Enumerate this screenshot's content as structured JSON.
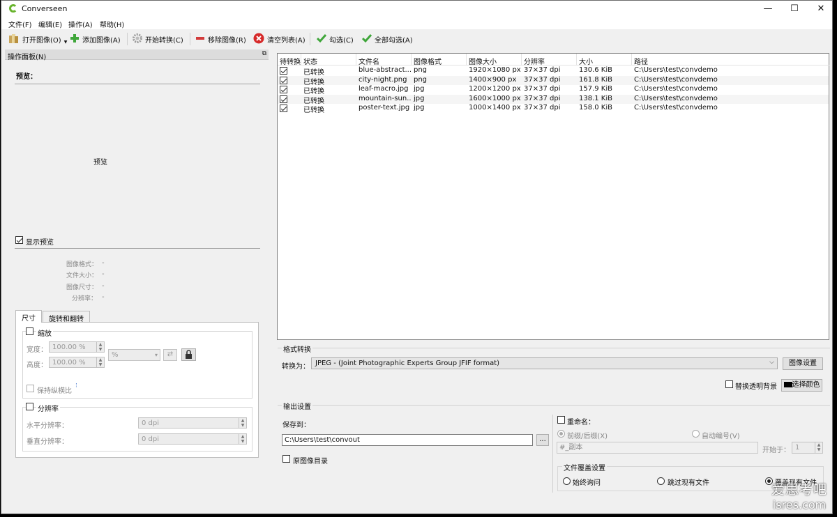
{
  "window": {
    "title": "Converseen",
    "min": "—",
    "max": "☐",
    "close": "✕"
  },
  "menu": [
    "文件(F)",
    "编辑(E)",
    "操作(A)",
    "帮助(H)"
  ],
  "toolbar": {
    "open": "打开图像(O)",
    "add": "添加图像(A)",
    "convert": "开始转换(C)",
    "remove": "移除图像(R)",
    "clear": "清空列表(A)",
    "check": "勾选(C)",
    "check_all": "全部勾选(A)"
  },
  "panel": {
    "title": "操作面板(N)",
    "preview_heading": "预览：",
    "preview_placeholder": "预览",
    "show_preview": "显示预览",
    "info": [
      {
        "label": "图像格式：",
        "value": "-"
      },
      {
        "label": "文件大小：",
        "value": "-"
      },
      {
        "label": "图像尺寸：",
        "value": "-"
      },
      {
        "label": "分辨率：",
        "value": "-"
      }
    ],
    "tabs": [
      "尺寸",
      "旋转和翻转"
    ],
    "scale": {
      "label": "缩放",
      "width_label": "宽度：",
      "width_value": "100.00 %",
      "height_label": "高度：",
      "height_value": "100.00 %",
      "unit": "%",
      "keep_ratio": "保持纵横比"
    },
    "resolution": {
      "label": "分辨率",
      "h_label": "水平分辨率：",
      "h_value": "0 dpi",
      "v_label": "垂直分辨率：",
      "v_value": "0 dpi"
    }
  },
  "list": {
    "headers": [
      "待转换",
      "状态",
      "文件名",
      "图像格式",
      "图像大小",
      "分辨率",
      "大小",
      "路径"
    ],
    "rows": [
      {
        "status": "已转换",
        "name": "blue-abstract....",
        "fmt": "png",
        "size": "1920×1080 px",
        "dpi": "37×37 dpi",
        "bytes": "130.6 KiB",
        "path": "C:\\Users\\test\\convdemo"
      },
      {
        "status": "已转换",
        "name": "city-night.png",
        "fmt": "png",
        "size": "1400×900 px",
        "dpi": "37×37 dpi",
        "bytes": "161.8 KiB",
        "path": "C:\\Users\\test\\convdemo"
      },
      {
        "status": "已转换",
        "name": "leaf-macro.jpg",
        "fmt": "jpg",
        "size": "1200×1200 px",
        "dpi": "37×37 dpi",
        "bytes": "157.9 KiB",
        "path": "C:\\Users\\test\\convdemo"
      },
      {
        "status": "已转换",
        "name": "mountain-sun....",
        "fmt": "jpg",
        "size": "1600×1000 px",
        "dpi": "37×37 dpi",
        "bytes": "138.1 KiB",
        "path": "C:\\Users\\test\\convdemo"
      },
      {
        "status": "已转换",
        "name": "poster-text.jpg",
        "fmt": "jpg",
        "size": "1000×1400 px",
        "dpi": "37×37 dpi",
        "bytes": "158.0 KiB",
        "path": "C:\\Users\\test\\convdemo"
      }
    ]
  },
  "format": {
    "group": "格式转换",
    "convert_to": "转换为：",
    "selected": "JPEG - (Joint Photographic Experts Group JFIF format)",
    "image_settings": "图像设置",
    "replace_bg": "替换透明背景",
    "choose_color": "选择颜色"
  },
  "output": {
    "group": "输出设置",
    "save_to": "保存到：",
    "path": "C:\\Users\\test\\convout",
    "browse": "...",
    "original_dir": "原图像目录",
    "rename": "重命名：",
    "prefix_suffix": "前缀/后缀(X)",
    "auto_number": "自动编号(V)",
    "pattern": "#_副本",
    "start_at": "开始于：",
    "start_value": "1",
    "overwrite_group": "文件覆盖设置",
    "always_ask": "始终询问",
    "skip_existing": "跳过现有文件",
    "overwrite": "覆盖现有文件"
  },
  "watermark": {
    "line1": "爱思考吧",
    "line2": "isres.com"
  }
}
